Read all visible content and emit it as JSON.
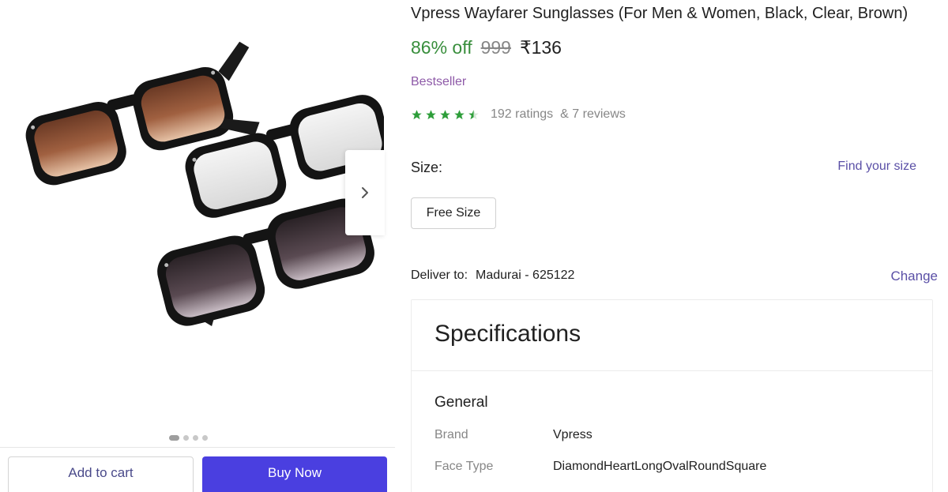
{
  "product": {
    "title": "Vpress Wayfarer Sunglasses (For Men & Women, Black, Clear, Brown)",
    "discount": "86% off",
    "mrp": "999",
    "price": "₹136",
    "badge": "Bestseller",
    "rating_stars": 4.5,
    "ratings_text": "192 ratings",
    "reviews_text": "& 7 reviews"
  },
  "gallery": {
    "image_count": 4,
    "active_index": 0
  },
  "size": {
    "label": "Size:",
    "find_size": "Find your size",
    "selected_option": "Free Size"
  },
  "delivery": {
    "label": "Deliver to:",
    "location": "Madurai - 625122",
    "change": "Change"
  },
  "specifications": {
    "title": "Specifications",
    "group": "General",
    "rows": [
      {
        "key": "Brand",
        "value": "Vpress"
      },
      {
        "key": "Face Type",
        "value": "DiamondHeartLongOvalRoundSquare"
      }
    ]
  },
  "actions": {
    "add_to_cart": "Add to cart",
    "buy_now": "Buy Now"
  },
  "colors": {
    "discount_green": "#388e3c",
    "star_green": "#2e9e3a",
    "bestseller_purple": "#8e5aa8",
    "link_purple": "#5a4fa6",
    "buy_now_bg": "#4a3fe0"
  },
  "icons": [
    "chevron-right-icon",
    "star-icon"
  ]
}
